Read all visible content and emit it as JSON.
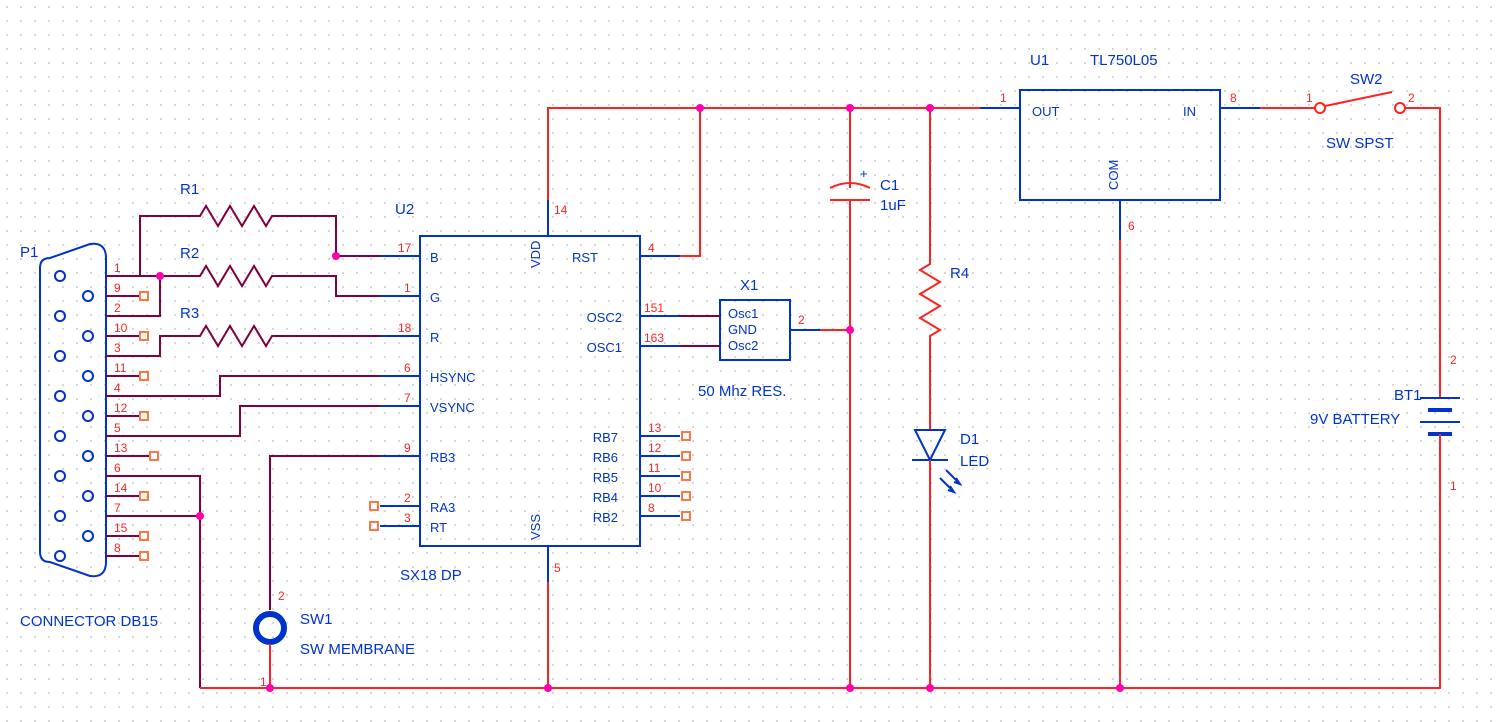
{
  "components": {
    "P1": {
      "ref": "P1",
      "name": "CONNECTOR DB15",
      "pins": [
        "1",
        "9",
        "2",
        "10",
        "3",
        "11",
        "4",
        "12",
        "5",
        "13",
        "6",
        "14",
        "7",
        "15",
        "8"
      ]
    },
    "R1": {
      "ref": "R1"
    },
    "R2": {
      "ref": "R2"
    },
    "R3": {
      "ref": "R3"
    },
    "R4": {
      "ref": "R4"
    },
    "U1": {
      "ref": "U1",
      "name": "TL750L05",
      "pins": {
        "out": "OUT",
        "in": "IN",
        "com": "COM",
        "p1": "1",
        "p8": "8",
        "p6": "6"
      }
    },
    "U2": {
      "ref": "U2",
      "name": "SX18 DP",
      "left": [
        {
          "n": "17",
          "l": "B"
        },
        {
          "n": "1",
          "l": "G"
        },
        {
          "n": "18",
          "l": "R"
        },
        {
          "n": "6",
          "l": "HSYNC"
        },
        {
          "n": "7",
          "l": "VSYNC"
        },
        {
          "n": "9",
          "l": "RB3"
        },
        {
          "n": "2",
          "l": "RA3"
        },
        {
          "n": "3",
          "l": "RT"
        }
      ],
      "right": [
        {
          "n": "4",
          "l": "RST"
        },
        {
          "n": "151",
          "l": "OSC2"
        },
        {
          "n": "163",
          "l": "OSC1"
        },
        {
          "n": "13",
          "l": "RB7"
        },
        {
          "n": "12",
          "l": "RB6"
        },
        {
          "n": "11",
          "l": "RB5"
        },
        {
          "n": "10",
          "l": "RB4"
        },
        {
          "n": "8",
          "l": "RB2"
        }
      ],
      "top": {
        "n": "14",
        "l": "VDD"
      },
      "bot": {
        "n": "5",
        "l": "VSS"
      }
    },
    "C1": {
      "ref": "C1",
      "val": "1uF"
    },
    "X1": {
      "ref": "X1",
      "name": "50 Mhz RES.",
      "lines": [
        "Osc1",
        "GND",
        "Osc2"
      ],
      "p2": "2"
    },
    "D1": {
      "ref": "D1",
      "name": "LED"
    },
    "SW1": {
      "ref": "SW1",
      "name": "SW MEMBRANE",
      "p1": "1",
      "p2": "2"
    },
    "SW2": {
      "ref": "SW2",
      "name": "SW SPST",
      "p1": "1",
      "p2": "2"
    },
    "BT1": {
      "ref": "BT1",
      "name": "9V BATTERY",
      "p1": "1",
      "p2": "2"
    }
  }
}
